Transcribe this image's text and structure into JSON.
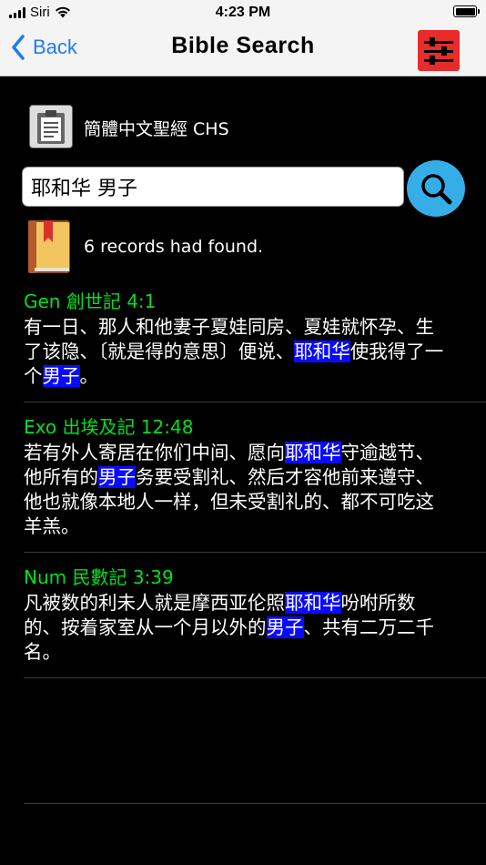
{
  "status": {
    "carrier": "Siri",
    "time": "4:23 PM"
  },
  "nav": {
    "back_label": "Back",
    "title": "Bible Search"
  },
  "version": {
    "label": "簡體中文聖經 CHS"
  },
  "search": {
    "value": "耶和华 男子"
  },
  "results": {
    "count_text": "6 records had found."
  },
  "verses": [
    {
      "ref": "Gen 創世記 4:1",
      "segments": [
        {
          "t": "有一日、那人和他妻子夏娃同房、夏娃就怀孕、生了该隐、〔就是得的意思〕便说、"
        },
        {
          "t": "耶和华",
          "hl": true
        },
        {
          "t": "使我得了一个"
        },
        {
          "t": "男子",
          "hl": true
        },
        {
          "t": "。"
        }
      ]
    },
    {
      "ref": "Exo 出埃及記 12:48",
      "segments": [
        {
          "t": "若有外人寄居在你们中间、愿向"
        },
        {
          "t": "耶和华",
          "hl": true
        },
        {
          "t": "守逾越节、他所有的"
        },
        {
          "t": "男子",
          "hl": true
        },
        {
          "t": "务要受割礼、然后才容他前来遵守、他也就像本地人一样，但未受割礼的、都不可吃这羊羔。"
        }
      ]
    },
    {
      "ref": "Num 民數記 3:39",
      "segments": [
        {
          "t": "凡被数的利未人就是摩西亚伦照"
        },
        {
          "t": "耶和华",
          "hl": true
        },
        {
          "t": "吩咐所数的、按着家室从一个月以外的"
        },
        {
          "t": "男子",
          "hl": true
        },
        {
          "t": "、共有二万二千名。"
        }
      ]
    }
  ],
  "colors": {
    "nav_bg": "#f4f4f4",
    "accent": "#1f7cf5",
    "reference": "#00e020",
    "highlight": "#0a0aff",
    "search_button": "#35aee8",
    "settings_button": "#e82b2b"
  },
  "icons": {
    "back": "chevron-left-icon",
    "settings": "sliders-icon",
    "version": "clipboard-icon",
    "search": "magnifier-icon",
    "results": "book-icon"
  }
}
